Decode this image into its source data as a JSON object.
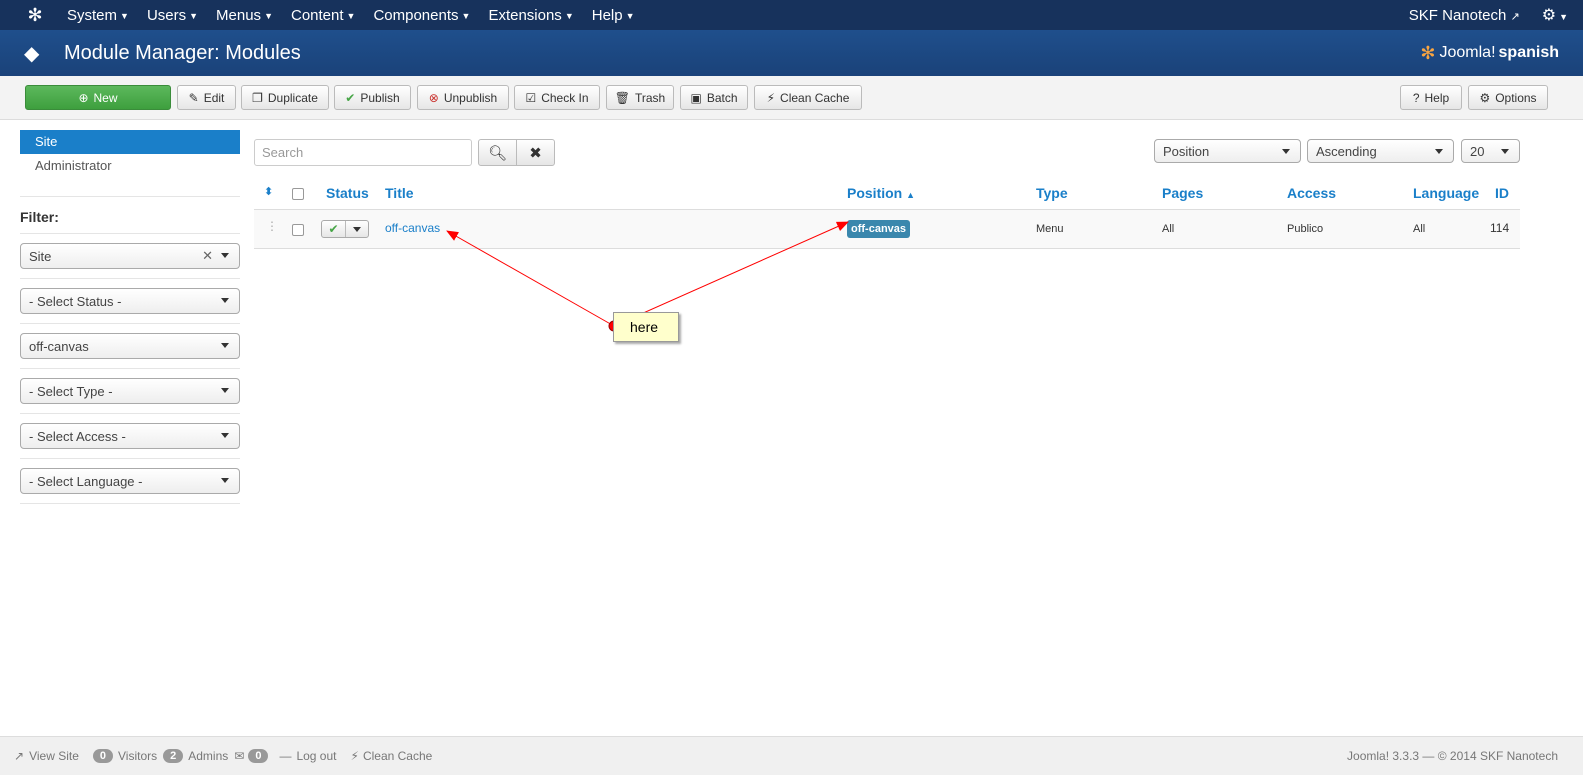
{
  "navbar": {
    "menu": [
      "System",
      "Users",
      "Menus",
      "Content",
      "Components",
      "Extensions",
      "Help"
    ],
    "site_name": "SKF Nanotech"
  },
  "header": {
    "title": "Module Manager: Modules",
    "brand_text": "Joomla!",
    "brand_suffix": "spanish"
  },
  "toolbar": {
    "new": "New",
    "edit": "Edit",
    "duplicate": "Duplicate",
    "publish": "Publish",
    "unpublish": "Unpublish",
    "checkin": "Check In",
    "trash": "Trash",
    "batch": "Batch",
    "clean_cache": "Clean Cache",
    "help": "Help",
    "options": "Options"
  },
  "sidebar": {
    "nav": [
      "Site",
      "Administrator"
    ],
    "filter_title": "Filter:",
    "filters": [
      "Site",
      "- Select Status -",
      "off-canvas",
      "- Select Type -",
      "- Select Access -",
      "- Select Language -"
    ]
  },
  "search": {
    "placeholder": "Search"
  },
  "list_controls": {
    "order_by": "Position",
    "direction": "Ascending",
    "limit": "20"
  },
  "table": {
    "headers": {
      "status": "Status",
      "title": "Title",
      "position": "Position",
      "type": "Type",
      "pages": "Pages",
      "access": "Access",
      "language": "Language",
      "id": "ID"
    },
    "rows": [
      {
        "title": "off-canvas",
        "position": "off-canvas",
        "type": "Menu",
        "pages": "All",
        "access": "Publico",
        "language": "All",
        "id": "114"
      }
    ]
  },
  "annotation": {
    "note": "here",
    "color": "#ff0000"
  },
  "footer": {
    "view_site": "View Site",
    "visitors_count": "0",
    "visitors": "Visitors",
    "admins_count": "2",
    "admins": "Admins",
    "messages_count": "0",
    "logout": "Log out",
    "clean_cache": "Clean Cache",
    "copyright": "Joomla! 3.3.3  —  © 2014 SKF Nanotech"
  }
}
